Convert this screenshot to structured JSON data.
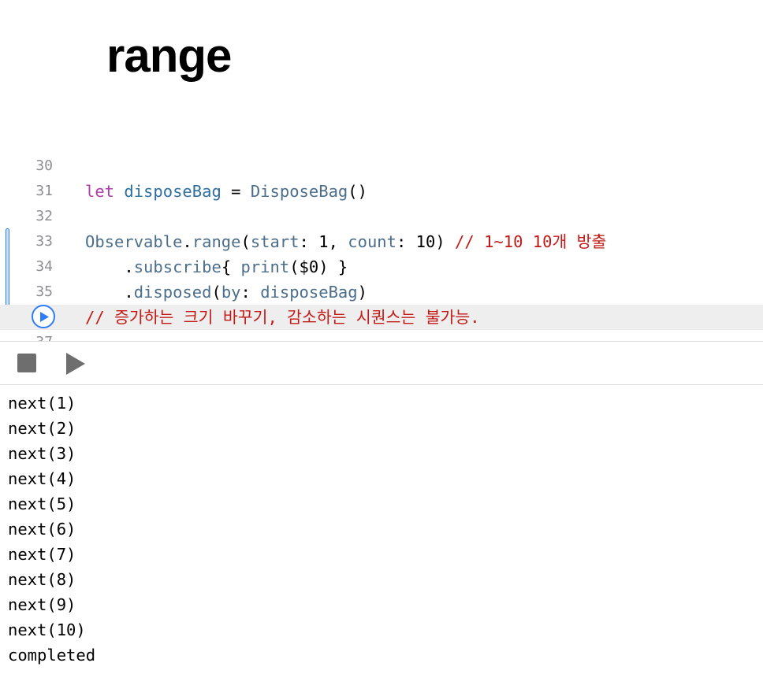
{
  "page": {
    "title": "range"
  },
  "editor": {
    "lines": [
      {
        "number": "30",
        "tokens": []
      },
      {
        "number": "31",
        "tokens": [
          {
            "text": "let",
            "kind": "kw"
          },
          {
            "text": " ",
            "kind": "plain"
          },
          {
            "text": "disposeBag",
            "kind": "var"
          },
          {
            "text": " = ",
            "kind": "plain"
          },
          {
            "text": "DisposeBag",
            "kind": "type"
          },
          {
            "text": "()",
            "kind": "plain"
          }
        ]
      },
      {
        "number": "32",
        "tokens": []
      },
      {
        "number": "33",
        "tokens": [
          {
            "text": "Observable",
            "kind": "type"
          },
          {
            "text": ".",
            "kind": "plain"
          },
          {
            "text": "range",
            "kind": "fn"
          },
          {
            "text": "(",
            "kind": "plain"
          },
          {
            "text": "start",
            "kind": "lbl"
          },
          {
            "text": ": 1, ",
            "kind": "plain"
          },
          {
            "text": "count",
            "kind": "lbl"
          },
          {
            "text": ": 10) ",
            "kind": "plain"
          },
          {
            "text": "// 1~10 10개 방출",
            "kind": "cmt"
          }
        ]
      },
      {
        "number": "34",
        "tokens": [
          {
            "text": "    .",
            "kind": "plain"
          },
          {
            "text": "subscribe",
            "kind": "fn"
          },
          {
            "text": "{ ",
            "kind": "plain"
          },
          {
            "text": "print",
            "kind": "fn"
          },
          {
            "text": "($0) }",
            "kind": "plain"
          }
        ]
      },
      {
        "number": "35",
        "tokens": [
          {
            "text": "    .",
            "kind": "plain"
          },
          {
            "text": "disposed",
            "kind": "fn"
          },
          {
            "text": "(",
            "kind": "plain"
          },
          {
            "text": "by",
            "kind": "lbl"
          },
          {
            "text": ": ",
            "kind": "plain"
          },
          {
            "text": "disposeBag",
            "kind": "fn"
          },
          {
            "text": ")",
            "kind": "plain"
          }
        ]
      },
      {
        "number": "",
        "current": true,
        "tokens": [
          {
            "text": "// 증가하는 크기 바꾸기, 감소하는 시퀀스는 불가능.",
            "kind": "cmt"
          }
        ]
      },
      {
        "number": "37",
        "tokens": []
      }
    ],
    "colors": {
      "keyword": "#ad3da4",
      "variable": "#2f6f9f",
      "type": "#4b6e8a",
      "comment": "#c41a16",
      "accent": "#2f7cf6"
    }
  },
  "toolbar": {
    "stop_icon": "stop-icon",
    "play_icon": "play-icon"
  },
  "console": {
    "output": [
      "next(1)",
      "next(2)",
      "next(3)",
      "next(4)",
      "next(5)",
      "next(6)",
      "next(7)",
      "next(8)",
      "next(9)",
      "next(10)",
      "completed"
    ]
  }
}
